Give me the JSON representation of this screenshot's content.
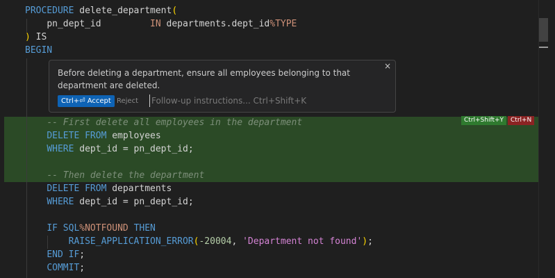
{
  "code": {
    "line1": {
      "kw": "PROCEDURE",
      "name": "delete_department",
      "paren": "("
    },
    "line2": {
      "param": "pn_dept_id",
      "mode": "IN",
      "ref": "departments.dept_id",
      "attr": "%TYPE"
    },
    "line3": {
      "paren": ")",
      "kw": "IS"
    },
    "line4": {
      "kw": "BEGIN"
    },
    "line5": {
      "comment": "-- First delete all employees in the department"
    },
    "line6": {
      "kw": "DELETE FROM",
      "table": "employees"
    },
    "line7": {
      "kw": "WHERE",
      "cond": "dept_id = pn_dept_id;"
    },
    "line8": {
      "comment": "-- Then delete the department"
    },
    "line9": {
      "kw": "DELETE FROM",
      "table": "departments"
    },
    "line10": {
      "kw": "WHERE",
      "cond": "dept_id = pn_dept_id;"
    },
    "line11": {
      "kw1": "IF",
      "sql": "SQL",
      "attr": "%NOTFOUND",
      "kw2": "THEN"
    },
    "line12": {
      "fn": "RAISE_APPLICATION_ERROR",
      "open": "(",
      "num": "-20004",
      "sep": ", ",
      "str": "'Department not found'",
      "close": ")",
      "end": ";"
    },
    "line13": {
      "kw": "END IF",
      "end": ";"
    },
    "line14": {
      "kw": "COMMIT",
      "end": ";"
    }
  },
  "inline_chat": {
    "message": "Before deleting a department, ensure all employees belonging to that department are deleted.",
    "accept_label": "Ctrl+⏎ Accept",
    "reject_label": "Reject",
    "followup_placeholder": "Follow-up instructions... Ctrl+Shift+K",
    "close_glyph": "×"
  },
  "diff_actions": {
    "accept_shortcut": "Ctrl+Shift+Y",
    "reject_shortcut": "Ctrl+N"
  },
  "colors": {
    "background": "#1f1f1f",
    "added_highlight": "#2b4a26",
    "accept_button": "#0e63b5",
    "keyword": "#569cd6",
    "string": "#d483d4"
  }
}
